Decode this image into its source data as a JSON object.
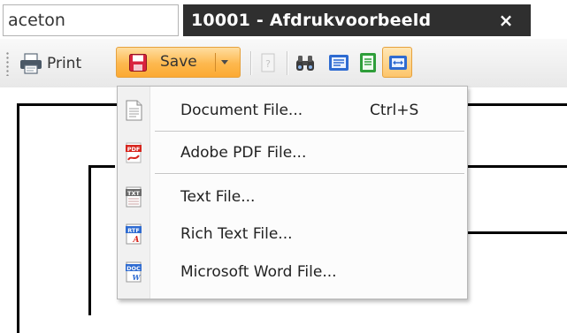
{
  "search": {
    "value": "aceton"
  },
  "tab": {
    "title": "10001 - Afdrukvoorbeeld",
    "close_label": "×"
  },
  "toolbar": {
    "print_label": "Print",
    "save_label": "Save"
  },
  "save_menu": {
    "items": [
      {
        "label": "Document File...",
        "shortcut": "Ctrl+S",
        "icon": "document-file-icon"
      },
      {
        "label": "Adobe PDF File...",
        "icon": "pdf-file-icon"
      },
      {
        "label": "Text File...",
        "icon": "txt-file-icon"
      },
      {
        "label": "Rich Text File...",
        "icon": "rtf-file-icon"
      },
      {
        "label": "Microsoft Word File...",
        "icon": "doc-file-icon"
      }
    ]
  },
  "colors": {
    "tab_bg": "#2f2f2f",
    "save_accent": "#fdb84e",
    "save_icon": "#d9233e",
    "blue_icon": "#2e6bd1",
    "green_icon": "#2f9e3a",
    "pdf_red": "#d7261e"
  }
}
